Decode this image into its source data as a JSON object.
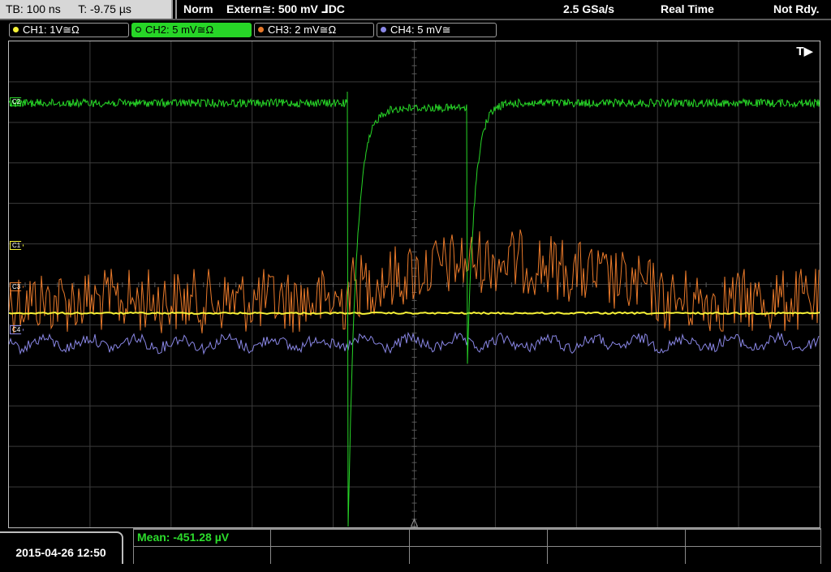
{
  "topbar": {
    "timebase": "TB: 100 ns",
    "trigger_time": "T: -9.75 µs",
    "mode": "Norm",
    "trigger": "Extern≅: 500 mV ⅃DC",
    "sample_rate": "2.5 GSa/s",
    "acq_mode": "Real Time",
    "status": "Not Rdy."
  },
  "channels": [
    {
      "label": "CH1: 1V≅Ω",
      "color": "#f6f237",
      "active": false
    },
    {
      "label": "CH2: 5 mV≅Ω",
      "color": "#27d627",
      "active": true
    },
    {
      "label": "CH3: 2 mV≅Ω",
      "color": "#e8792a",
      "active": false
    },
    {
      "label": "CH4: 5 mV≅",
      "color": "#8a87e6",
      "active": false
    }
  ],
  "screen": {
    "trigger_label": "T▶",
    "markers": {
      "c1": "C1",
      "c2": "C2",
      "c3": "C3",
      "c4": "C4"
    }
  },
  "bottom": {
    "datetime": "2015-04-26 12:50",
    "mean": "Mean: -451.28 µV"
  }
}
